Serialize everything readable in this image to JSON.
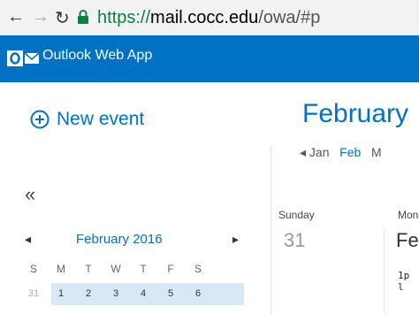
{
  "browser": {
    "url_scheme": "https://",
    "url_host": "mail.cocc.edu",
    "url_path": "/owa/#p"
  },
  "app": {
    "title": "Outlook Web App",
    "brand_color": "#0072c6"
  },
  "new_event": {
    "label": "New event"
  },
  "mini_calendar": {
    "collapse_label": "«",
    "prev_label": "◂",
    "next_label": "▸",
    "title": "February 2016",
    "weekdays": [
      "S",
      "M",
      "T",
      "W",
      "T",
      "F",
      "S"
    ],
    "first_week": [
      "31",
      "1",
      "2",
      "3",
      "4",
      "5",
      "6"
    ]
  },
  "main": {
    "month_title": "February",
    "prev_month": "Jan",
    "current_month": "Feb",
    "next_month_initial": "M",
    "columns": [
      {
        "day_name": "Sunday",
        "date": "31"
      },
      {
        "day_name": "Mon",
        "date": "Fel"
      }
    ],
    "event_time": "1p l"
  }
}
